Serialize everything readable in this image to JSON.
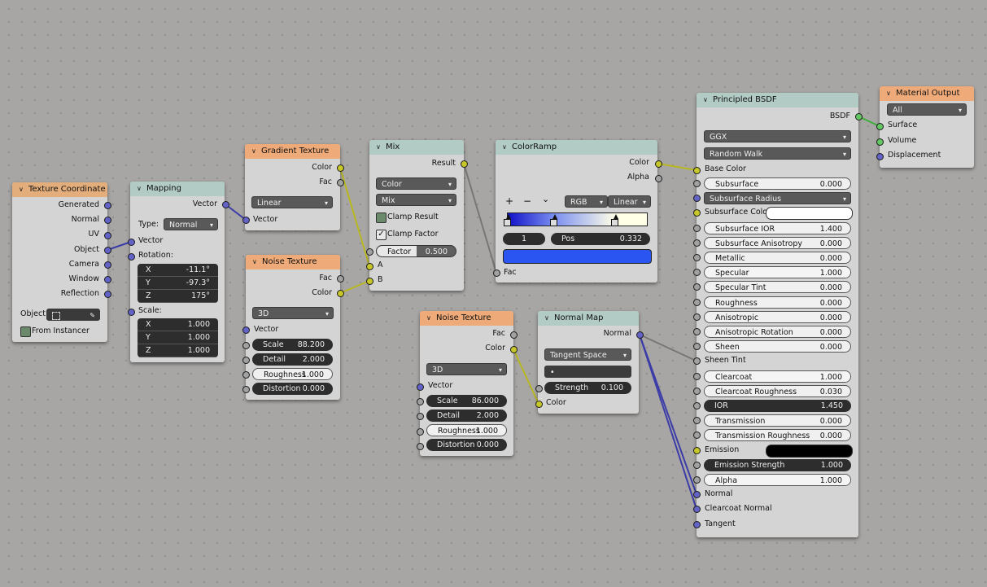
{
  "colors": {
    "vector_socket": "#6363c7",
    "color_socket": "#c7c729",
    "float_socket": "#a1a1a1",
    "shader_socket": "#63c763",
    "input_header": "#e4ae7c",
    "texture_header": "#eeaa78",
    "vector_header": "#b2cbc4"
  },
  "tex_coord": {
    "title": "Texture Coordinate",
    "outputs": [
      "Generated",
      "Normal",
      "UV",
      "Object",
      "Camera",
      "Window",
      "Reflection"
    ],
    "object_label": "Object:",
    "from_instancer": "From Instancer",
    "eyedropper_icon": "eyedropper-icon",
    "object_icon": "object-icon"
  },
  "mapping": {
    "title": "Mapping",
    "out_vector": "Vector",
    "type_label": "Type:",
    "type_value": "Normal",
    "in_vector": "Vector",
    "rotation_label": "Rotation:",
    "rotation": [
      {
        "axis": "X",
        "value": "-11.1°"
      },
      {
        "axis": "Y",
        "value": "-97.3°"
      },
      {
        "axis": "Z",
        "value": "175°"
      }
    ],
    "scale_label": "Scale:",
    "scale": [
      {
        "axis": "X",
        "value": "1.000"
      },
      {
        "axis": "Y",
        "value": "1.000"
      },
      {
        "axis": "Z",
        "value": "1.000"
      }
    ]
  },
  "gradient": {
    "title": "Gradient Texture",
    "out_color": "Color",
    "out_fac": "Fac",
    "type_value": "Linear",
    "in_vector": "Vector"
  },
  "noise1": {
    "title": "Noise Texture",
    "out_fac": "Fac",
    "out_color": "Color",
    "dim_value": "3D",
    "in_vector": "Vector",
    "fields": [
      {
        "label": "Scale",
        "value": "88.200",
        "style": "dark"
      },
      {
        "label": "Detail",
        "value": "2.000",
        "style": "dark"
      },
      {
        "label": "Roughness",
        "value": "1.000",
        "style": "light"
      },
      {
        "label": "Distortion",
        "value": "0.000",
        "style": "dark"
      }
    ]
  },
  "mix": {
    "title": "Mix",
    "out_result": "Result",
    "type_value": "Color",
    "blend_value": "Mix",
    "clamp_result": "Clamp Result",
    "clamp_factor": "Clamp Factor",
    "factor_label": "Factor",
    "factor_value": "0.500",
    "factor_fraction": 0.5,
    "in_a": "A",
    "in_b": "B"
  },
  "colorramp": {
    "title": "ColorRamp",
    "out_color": "Color",
    "out_alpha": "Alpha",
    "plus": "+",
    "minus": "−",
    "menu": "⌄",
    "color_mode": "RGB",
    "interpolation": "Linear",
    "stop_index": "1",
    "pos_label": "Pos",
    "pos_value": "0.332",
    "stop_color": "#2a55f0",
    "in_fac": "Fac",
    "stops": [
      0.0,
      0.332,
      0.77
    ],
    "ramp_colors": [
      "#1010c8",
      "#7a8ef0",
      "#ffffe8"
    ]
  },
  "noise2": {
    "title": "Noise Texture",
    "out_fac": "Fac",
    "out_color": "Color",
    "dim_value": "3D",
    "in_vector": "Vector",
    "fields": [
      {
        "label": "Scale",
        "value": "86.000",
        "style": "dark"
      },
      {
        "label": "Detail",
        "value": "2.000",
        "style": "dark"
      },
      {
        "label": "Roughness",
        "value": "1.000",
        "style": "light"
      },
      {
        "label": "Distortion",
        "value": "0.000",
        "style": "dark"
      }
    ]
  },
  "normalmap": {
    "title": "Normal Map",
    "out_normal": "Normal",
    "space_value": "Tangent Space",
    "uv_value": "•",
    "strength_label": "Strength",
    "strength_value": "0.100",
    "in_color": "Color"
  },
  "bsdf": {
    "title": "Principled BSDF",
    "out_bsdf": "BSDF",
    "distribution": "GGX",
    "subsurface_method": "Random Walk",
    "base_color": "Base Color",
    "rows": [
      {
        "label": "Subsurface",
        "value": "0.000",
        "sock": "flt",
        "style": "light",
        "frac": 0
      },
      {
        "label": "Subsurface Radius",
        "value": "",
        "sock": "vec",
        "style": "select",
        "frac": 0
      },
      {
        "label": "Subsurface Color",
        "value": "",
        "sock": "col",
        "style": "colorwhite",
        "frac": 0
      },
      {
        "label": "Subsurface IOR",
        "value": "1.400",
        "sock": "flt",
        "style": "light",
        "frac": 0
      },
      {
        "label": "Subsurface Anisotropy",
        "value": "0.000",
        "sock": "flt",
        "style": "light",
        "frac": 0
      },
      {
        "label": "Metallic",
        "value": "0.000",
        "sock": "flt",
        "style": "light",
        "frac": 0
      },
      {
        "label": "Specular",
        "value": "1.000",
        "sock": "flt",
        "style": "light",
        "frac": 1
      },
      {
        "label": "Specular Tint",
        "value": "0.000",
        "sock": "flt",
        "style": "light",
        "frac": 0
      },
      {
        "label": "Roughness",
        "value": "0.000",
        "sock": "flt",
        "style": "light",
        "frac": 0
      },
      {
        "label": "Anisotropic",
        "value": "0.000",
        "sock": "flt",
        "style": "light",
        "frac": 0
      },
      {
        "label": "Anisotropic Rotation",
        "value": "0.000",
        "sock": "flt",
        "style": "light",
        "frac": 0
      },
      {
        "label": "Sheen",
        "value": "0.000",
        "sock": "flt",
        "style": "light",
        "frac": 0
      },
      {
        "label": "Sheen Tint",
        "value": "",
        "sock": "flt",
        "style": "plain",
        "frac": 0
      },
      {
        "label": "Clearcoat",
        "value": "1.000",
        "sock": "flt",
        "style": "light",
        "frac": 1
      },
      {
        "label": "Clearcoat Roughness",
        "value": "0.030",
        "sock": "flt",
        "style": "light",
        "frac": 0.03
      },
      {
        "label": "IOR",
        "value": "1.450",
        "sock": "flt",
        "style": "dark",
        "frac": 0
      },
      {
        "label": "Transmission",
        "value": "0.000",
        "sock": "flt",
        "style": "light",
        "frac": 0
      },
      {
        "label": "Transmission Roughness",
        "value": "0.000",
        "sock": "flt",
        "style": "light",
        "frac": 0
      },
      {
        "label": "Emission",
        "value": "",
        "sock": "col",
        "style": "colorblack",
        "frac": 0
      },
      {
        "label": "Emission Strength",
        "value": "1.000",
        "sock": "flt",
        "style": "dark",
        "frac": 0
      },
      {
        "label": "Alpha",
        "value": "1.000",
        "sock": "flt",
        "style": "light",
        "frac": 1
      },
      {
        "label": "Normal",
        "value": "",
        "sock": "vec",
        "style": "plain",
        "frac": 0
      },
      {
        "label": "Clearcoat Normal",
        "value": "",
        "sock": "vec",
        "style": "plain",
        "frac": 0
      },
      {
        "label": "Tangent",
        "value": "",
        "sock": "vec",
        "style": "plain",
        "frac": 0
      }
    ]
  },
  "output": {
    "title": "Material Output",
    "target": "All",
    "inputs": [
      "Surface",
      "Volume",
      "Displacement"
    ]
  }
}
